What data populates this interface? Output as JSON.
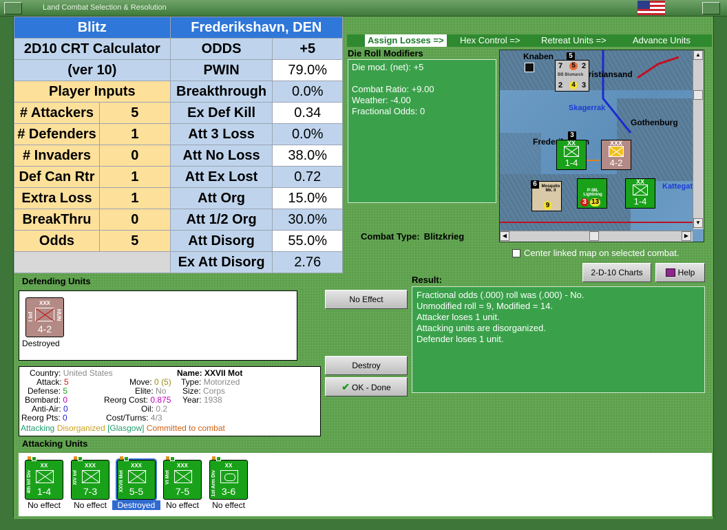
{
  "window": {
    "title": "Land Combat Selection & Resolution"
  },
  "steps": [
    "Assign Losses =>",
    "Hex Control =>",
    "Retreat Units =>",
    "Advance Units"
  ],
  "calc": {
    "header_left": "Blitz",
    "header_right": "Frederikshavn, DEN",
    "title_line1": "2D10 CRT Calculator",
    "title_line2": "(ver 10)",
    "inputs_header": "Player Inputs",
    "inputs": [
      {
        "label": "# Attackers",
        "value": "5"
      },
      {
        "label": "# Defenders",
        "value": "1"
      },
      {
        "label": "# Invaders",
        "value": "0"
      },
      {
        "label": "Def Can Rtr",
        "value": "1"
      },
      {
        "label": "Extra Loss",
        "value": "1"
      },
      {
        "label": "BreakThru",
        "value": "0"
      },
      {
        "label": "Odds",
        "value": "5"
      }
    ],
    "outputs": [
      {
        "label": "ODDS",
        "value": "+5"
      },
      {
        "label": "PWIN",
        "value": "79.0%"
      },
      {
        "label": "Breakthrough",
        "value": "0.0%"
      },
      {
        "label": "Ex Def Kill",
        "value": "0.34"
      },
      {
        "label": "Att 3 Loss",
        "value": "0.0%"
      },
      {
        "label": "Att No Loss",
        "value": "38.0%"
      },
      {
        "label": "Att Ex Lost",
        "value": "0.72"
      },
      {
        "label": "Att Org",
        "value": "15.0%"
      },
      {
        "label": "Att 1/2 Org",
        "value": "30.0%"
      },
      {
        "label": "Att Disorg",
        "value": "55.0%"
      },
      {
        "label": "Ex Att Disorg",
        "value": "2.76"
      }
    ]
  },
  "die_roll": {
    "title": "Die Roll Modifiers",
    "lines": [
      "Die mod. (net): +5",
      "",
      "Combat Ratio: +9.00",
      "Weather: -4.00",
      "Fractional Odds: 0"
    ]
  },
  "map": {
    "labels": [
      "Knaben",
      "Kristiansand",
      "Skagerrak",
      "Gothenburg",
      "Frederikshavn",
      "Kattegat"
    ],
    "counters": {
      "bismarck": {
        "stack": "5",
        "top_left": "7",
        "top_mid": "5",
        "top_right": "2",
        "name": "BB Bismarck",
        "bot_left": "2",
        "bot_mid": "4",
        "bot_right": "3"
      },
      "def_unit": {
        "size": "XXX",
        "val": "4-2"
      },
      "att_unit": {
        "size": "XX",
        "val": "1-4",
        "stack": "3"
      },
      "mosquito": {
        "stack": "6",
        "name": "Mosquito Mk. II",
        "val": "9"
      },
      "p38": {
        "name": "P-38L Lightning",
        "left": "3",
        "right": "13"
      },
      "att_unit2": {
        "size": "XX",
        "val": "1-4"
      }
    }
  },
  "combat_type": {
    "label": "Combat Type:",
    "value": "Blitzkrieg"
  },
  "center_linked": "Center linked map on selected combat.",
  "buttons": {
    "charts": "2-D-10 Charts",
    "help": "Help",
    "no_effect": "No Effect",
    "destroy": "Destroy",
    "ok_done": "OK - Done"
  },
  "defending": {
    "title": "Defending Units",
    "unit": {
      "size": "XXX",
      "side": "I Inf",
      "side_r": "HUN",
      "val": "4-2",
      "status": "Destroyed"
    }
  },
  "info": {
    "country_label": "Country:",
    "country": "United States",
    "name_label": "Name:",
    "name": "XXVII Mot",
    "attack_label": "Attack:",
    "attack": "5",
    "move_label": "Move:",
    "move": "0",
    "move_max": "(5)",
    "type_label": "Type:",
    "type": "Motorized",
    "defense_label": "Defense:",
    "defense": "5",
    "elite_label": "Elite:",
    "elite": "No",
    "size_label": "Size:",
    "size": "Corps",
    "bombard_label": "Bombard:",
    "bombard": "0",
    "reorg_label": "Reorg Cost:",
    "reorg": "0.875",
    "year_label": "Year:",
    "year": "1938",
    "antiair_label": "Anti-Air:",
    "antiair": "0",
    "oil_label": "Oil:",
    "oil": "0.2",
    "reorgpts_label": "Reorg Pts:",
    "reorgpts": "0",
    "cost_label": "Cost/Turns:",
    "cost": "4/3",
    "status_attacking": "Attacking",
    "status_disorg": "Disorganized",
    "status_loc": "[Glasgow]",
    "status_committed": "Committed to combat"
  },
  "result": {
    "title": "Result:",
    "lines": [
      "Fractional odds (.000) roll was (.000)  - No.",
      "Unmodified roll = 9, Modified = 14.",
      "Attacker loses 1 unit.",
      "Attacking units are disorganized.",
      "Defender loses 1 unit."
    ]
  },
  "attacking": {
    "title": "Attacking Units",
    "units": [
      {
        "size": "XX",
        "side": "4th Inf Div",
        "val": "1-4",
        "status": "No effect"
      },
      {
        "size": "XXX",
        "side": "XIV Inf",
        "val": "7-3",
        "status": "No effect"
      },
      {
        "size": "XXX",
        "side": "XXVII Mot",
        "val": "5-5",
        "status": "Destroyed"
      },
      {
        "size": "XXX",
        "side": "VI Mot",
        "val": "7-5",
        "status": "No effect"
      },
      {
        "size": "XX",
        "side": "1st Arm Div",
        "val": "3-6",
        "status": "No effect"
      }
    ]
  },
  "colors": {
    "accent_blue": "#2f77d8",
    "panel_green": "#3aa14a",
    "input_yellow": "#fde09a",
    "output_lightblue": "#bfd4ec",
    "unit_green": "#1aa11a",
    "enemy_tan": "#b38a85",
    "attack_red": "#d21a1a",
    "defense_green": "#1f9d1f",
    "bombard_magenta": "#c000c0",
    "antiair_blue": "#2020d0"
  },
  "icons": [
    "system-menu-icon",
    "us-flag-icon",
    "close-icon",
    "checkmark-icon",
    "help-book-icon",
    "infantry-icon",
    "armor-icon",
    "aircraft-icon",
    "battleship-icon"
  ]
}
